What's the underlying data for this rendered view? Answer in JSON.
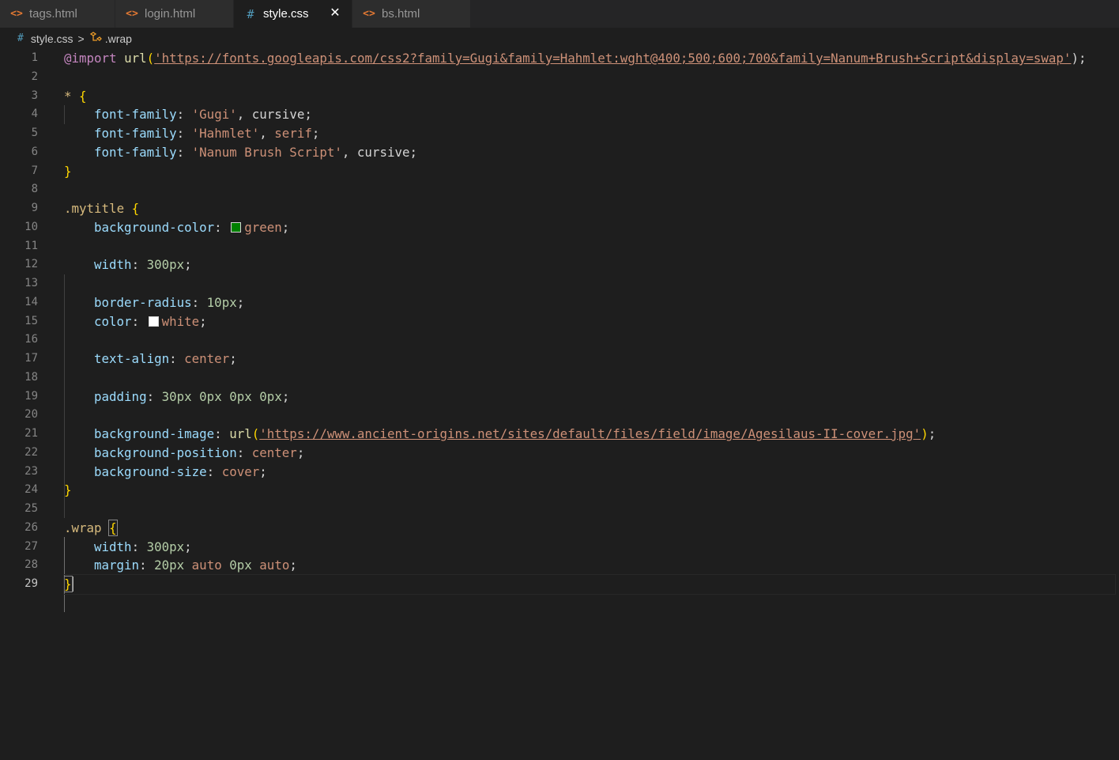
{
  "tabs": [
    {
      "label": "tags.html",
      "icon": "html-file-icon",
      "active": false
    },
    {
      "label": "login.html",
      "icon": "html-file-icon",
      "active": false
    },
    {
      "label": "style.css",
      "icon": "css-file-icon",
      "active": true
    },
    {
      "label": "bs.html",
      "icon": "html-file-icon",
      "active": false
    }
  ],
  "icons": {
    "html": "<>",
    "css": "#",
    "close": "✕",
    "chevron": ">"
  },
  "breadcrumb": {
    "file": "style.css",
    "symbol": ".wrap"
  },
  "current_line": 29,
  "code": {
    "l1_at": "@import",
    "l1_fn": "url",
    "l1_open": "(",
    "l1_url": "'https://fonts.googleapis.com/css2?family=Gugi&family=Hahmlet:wght@400;500;600;700&family=Nanum+Brush+Script&display=swap'",
    "l1_close": ");",
    "l3_sel": "*",
    "l3_brace": "{",
    "l4_prop": "font-family",
    "l4_str": "'Gugi'",
    "l4_val": "cursive",
    "l5_prop": "font-family",
    "l5_str": "'Hahmlet'",
    "l5_val": "serif",
    "l6_prop": "font-family",
    "l6_str": "'Nanum Brush Script'",
    "l6_val": "cursive",
    "l7_brace": "}",
    "l9_sel": ".mytitle",
    "l9_brace": "{",
    "l10_prop": "background-color",
    "l10_val": "green",
    "l10_swatch": "#008000",
    "l12_prop": "width",
    "l12_num": "300px",
    "l14_prop": "border-radius",
    "l14_num": "10px",
    "l15_prop": "color",
    "l15_val": "white",
    "l15_swatch": "#ffffff",
    "l17_prop": "text-align",
    "l17_val": "center",
    "l19_prop": "padding",
    "l19_n1": "30px",
    "l19_n2": "0px",
    "l19_n3": "0px",
    "l19_n4": "0px",
    "l21_prop": "background-image",
    "l21_fn": "url",
    "l21_url": "'https://www.ancient-origins.net/sites/default/files/field/image/Agesilaus-II-cover.jpg'",
    "l22_prop": "background-position",
    "l22_val": "center",
    "l23_prop": "background-size",
    "l23_val": "cover",
    "l24_brace": "}",
    "l26_sel": ".wrap",
    "l26_brace": "{",
    "l27_prop": "width",
    "l27_num": "300px",
    "l28_prop": "margin",
    "l28_n1": "20px",
    "l28_v1": "auto",
    "l28_n2": "0px",
    "l28_v2": "auto",
    "l29_brace": "}"
  }
}
